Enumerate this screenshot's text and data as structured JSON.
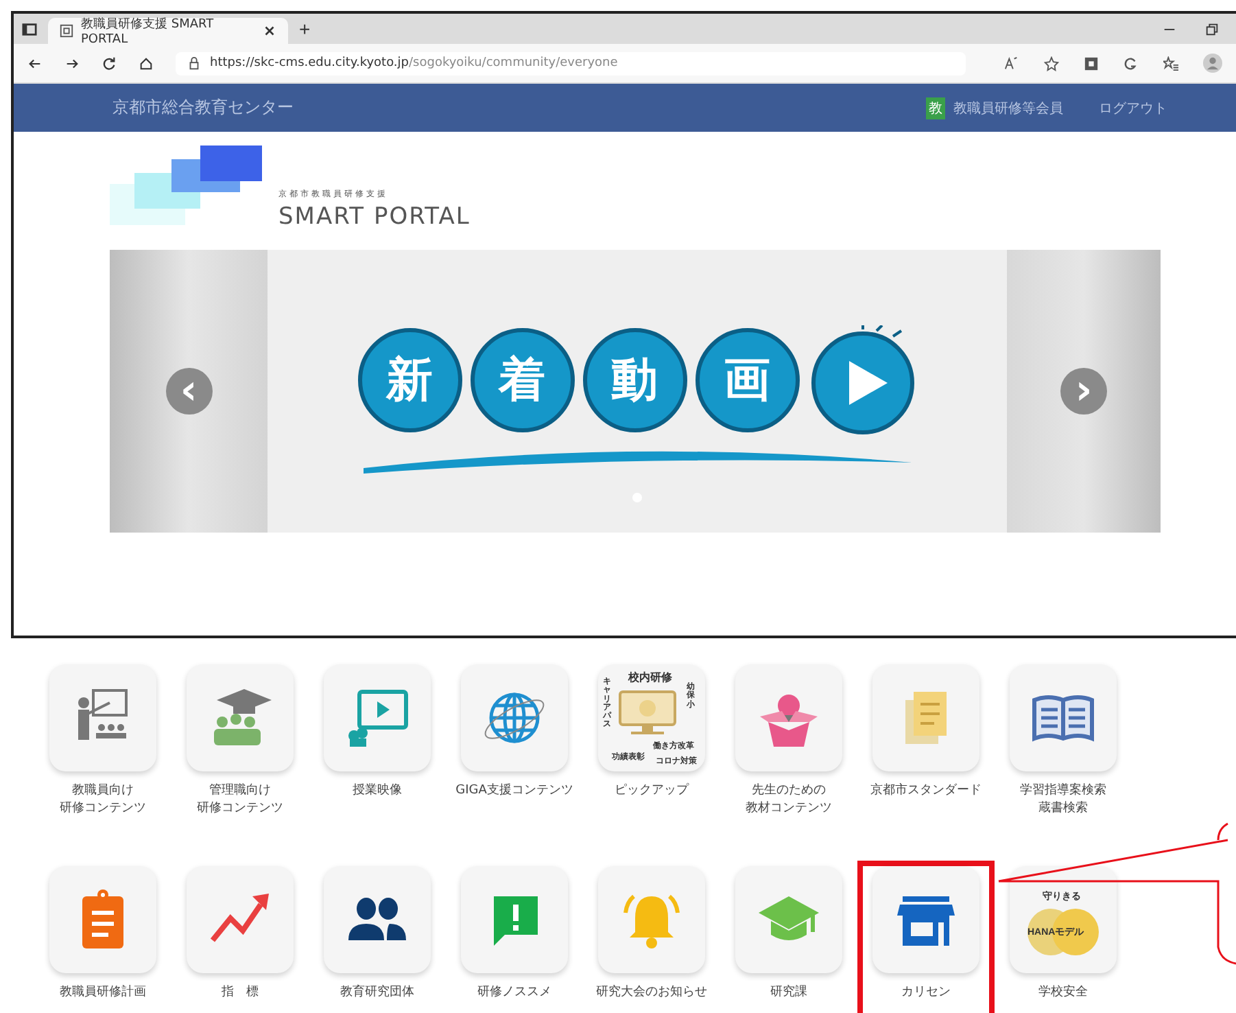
{
  "browser": {
    "tab": {
      "title": "教職員研修支援 SMART PORTAL"
    },
    "new_tab": "+",
    "address": {
      "host": "https://skc-cms.edu.city.kyoto.jp",
      "path": "/sogokyoiku/community/everyone"
    }
  },
  "header": {
    "site_name": "京都市総合教育センター",
    "member_badge": "教",
    "member_label": "教職員研修等会員",
    "logout": "ログアウト"
  },
  "logo": {
    "subtitle": "京都市教職員研修支援",
    "title": "SMART PORTAL"
  },
  "carousel": {
    "prev": "‹",
    "next": "›",
    "banner_chars": [
      "新",
      "着",
      "動",
      "画"
    ],
    "slides": [
      {
        "selected": true
      }
    ]
  },
  "tiles_row_1": [
    {
      "label": [
        "教職員向け",
        "研修コンテンツ"
      ],
      "highlighted": false
    },
    {
      "label": [
        "管理職向け",
        "研修コンテンツ"
      ],
      "highlighted": false
    },
    {
      "label": "授業映像",
      "highlighted": false
    },
    {
      "label": "GIGA支援コンテンツ",
      "highlighted": false
    },
    {
      "label": "ピックアップ",
      "highlighted": false,
      "icon_texts": [
        "校内研修",
        "幼保小",
        "キャリアパス",
        "働き方改革",
        "功績表彰",
        "コロナ対策"
      ]
    },
    {
      "label": [
        "先生のための",
        "教材コンテンツ"
      ],
      "highlighted": false
    },
    {
      "label": "京都市スタンダード",
      "highlighted": false
    },
    {
      "label": [
        "学習指導案検索",
        "蔵書検索"
      ],
      "highlighted": false
    }
  ],
  "tiles_row_2": [
    {
      "label": "教職員研修計画",
      "highlighted": false
    },
    {
      "label": "指　標",
      "highlighted": false
    },
    {
      "label": "教育研究団体",
      "highlighted": false
    },
    {
      "label": "研修ノススメ",
      "highlighted": false
    },
    {
      "label": "研究大会のお知らせ",
      "highlighted": false
    },
    {
      "label": "研究課",
      "highlighted": false
    },
    {
      "label": "カリセン",
      "highlighted": true
    },
    {
      "label": "学校安全",
      "highlighted": false,
      "icon_texts": [
        "守りきる",
        "HANAモデル"
      ]
    }
  ]
}
